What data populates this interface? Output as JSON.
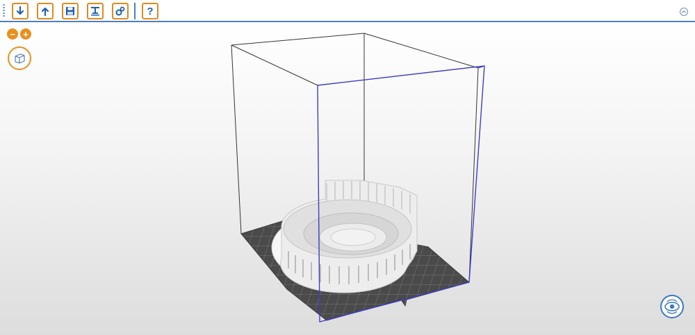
{
  "toolbar": {
    "buttons": [
      {
        "name": "import-button",
        "icon": "arrow-down-icon"
      },
      {
        "name": "export-button",
        "icon": "arrow-up-icon"
      },
      {
        "name": "save-button",
        "icon": "floppy-disk-icon"
      },
      {
        "name": "print-button",
        "icon": "printer-icon"
      },
      {
        "name": "settings-button",
        "icon": "gears-icon"
      }
    ],
    "help_label": "?",
    "collapse_icon": "chevron-up-icon"
  },
  "viewport": {
    "zoom_out_label": "−",
    "zoom_in_label": "+",
    "view_cube_icon": "cube-icon",
    "camera_icon": "eye-orbit-icon",
    "colors": {
      "accent": "#e8901f",
      "toolbar_border": "#4a7fc1",
      "selection_outline": "#3c3cc8",
      "build_volume": "#333333",
      "build_plate": "#4a4a4a"
    }
  }
}
